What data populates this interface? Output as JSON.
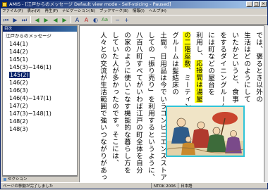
{
  "window": {
    "title": "AMIS - [江戸からのメッセージ Default view mode - Self-voicing - Paused]",
    "controls": [
      "_",
      "□",
      "×"
    ]
  },
  "menu": [
    "ファイル(F)",
    "表示(V)",
    "再生(P)",
    "ナビゲーション(N)",
    "ブックマーク(B)",
    "情報(I)",
    "ヘルプ(H)"
  ],
  "toolbar": {
    "buttons": [
      {
        "name": "prev-section",
        "glyph": "⏮"
      },
      {
        "name": "play",
        "glyph": "▶"
      },
      {
        "name": "next-section",
        "glyph": "⏭"
      },
      {
        "name": "back",
        "glyph": "◀"
      },
      {
        "name": "forward",
        "glyph": "▶"
      },
      {
        "name": "rewind",
        "glyph": "◀"
      },
      {
        "name": "fast-forward",
        "glyph": "▶"
      },
      {
        "name": "font-size",
        "glyph": "A"
      },
      {
        "name": "font-color",
        "glyph": "A"
      },
      {
        "name": "contrast",
        "glyph": "◐"
      },
      {
        "name": "style",
        "glyph": "Aa"
      },
      {
        "name": "volume-down",
        "glyph": "−"
      },
      {
        "name": "volume-up",
        "glyph": "+"
      }
    ]
  },
  "sidebar": {
    "header": "目次",
    "root": "江戸からのメッセージ",
    "items": [
      "144(1)",
      "144(2)",
      "145(1)",
      "145(3)−146(1)",
      "145(2)",
      "146(2)",
      "146(3)",
      "146(4)−147(1)",
      "147(2)",
      "147(3)−148(1)",
      "148(2)",
      "148(3)"
    ],
    "selected_index": 4,
    "tab": "セクション"
  },
  "reader": {
    "columns": [
      {
        "text": "では、褒るとき以外の"
      },
      {
        "text": "生活はどのようにして"
      },
      {
        "text": "いたかというと、食事"
      },
      {
        "text": "をするダイニングルーム"
      },
      {
        "text": "には町などの屋台を"
      },
      {
        "text": "利用し、",
        "highlight": "応接間は湯屋"
      },
      {
        "text": "",
        "highlight": "の二階座敷",
        "tail": "、ミーティン"
      },
      {
        "text": "グルームは髪結床の"
      },
      {
        "text": "土間。日用品は今でいうコンビニエンスストアと"
      },
      {
        "text": "しての「振り売り」を利用するというように、"
      },
      {
        "text": "八百八町すべてがいわば江戸の町全体を自分"
      },
      {
        "text": "の家のように使いこなす機能的な暮らし方を"
      },
      {
        "text": "していた人が多かったのです。そこには、"
      },
      {
        "text": "人々との交流が生活範囲で強いつながりがあった。"
      }
    ]
  },
  "status": {
    "main": "ページの移動が完了しました",
    "cells": [
      "NTOK 2006",
      "日本語"
    ]
  }
}
